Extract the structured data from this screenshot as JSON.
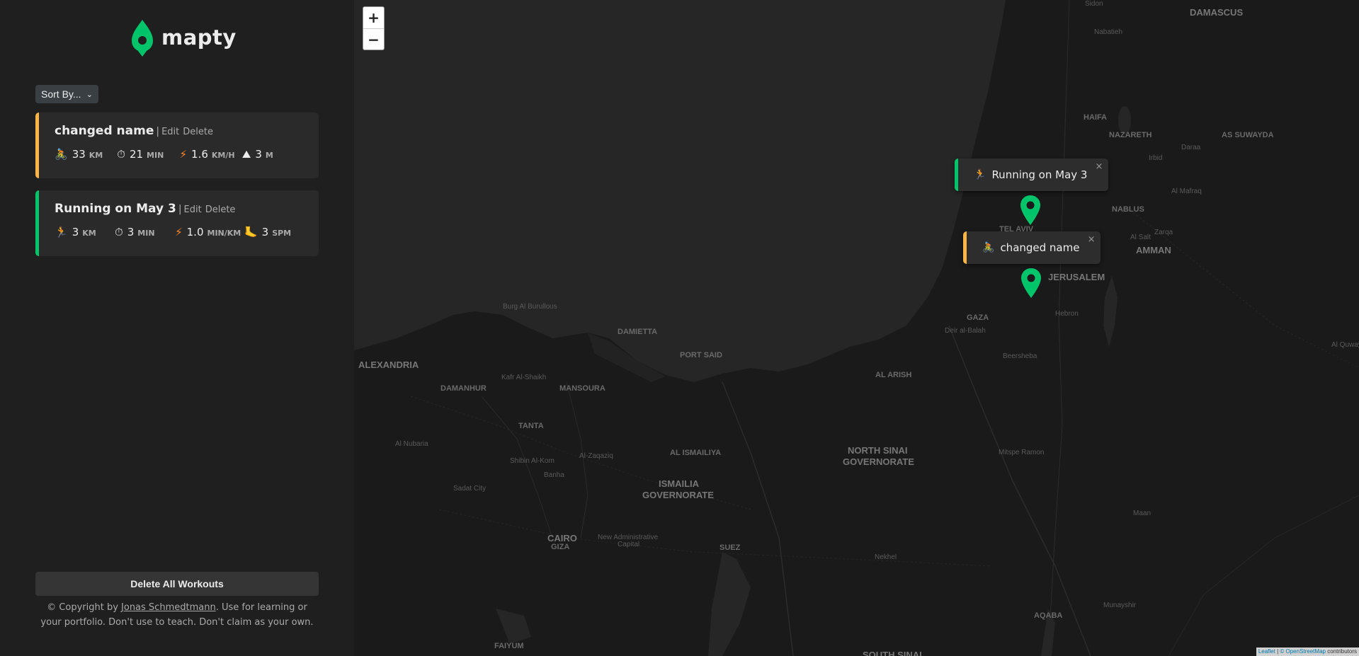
{
  "app": {
    "name": "mapty"
  },
  "sidebar": {
    "sort_label": "Sort By...",
    "workouts": [
      {
        "type": "cycling",
        "title": "changed name",
        "edit": "Edit",
        "delete": "Delete",
        "details": [
          {
            "icon": "🚴",
            "value": "33",
            "unit": "km"
          },
          {
            "icon": "⏱",
            "value": "21",
            "unit": "min"
          },
          {
            "icon": "⚡",
            "value": "1.6",
            "unit": "km/h"
          },
          {
            "icon": "⛰",
            "value": "3",
            "unit": "m"
          }
        ]
      },
      {
        "type": "running",
        "title": "Running on May 3",
        "edit": "Edit",
        "delete": "Delete",
        "details": [
          {
            "icon": "🏃",
            "value": "3",
            "unit": "km"
          },
          {
            "icon": "⏱",
            "value": "3",
            "unit": "min"
          },
          {
            "icon": "⚡",
            "value": "1.0",
            "unit": "min/km"
          },
          {
            "icon": "🦶",
            "value": "3",
            "unit": "spm"
          }
        ]
      }
    ],
    "delete_all_label": "Delete All Workouts",
    "copyright": {
      "prefix": "© Copyright by ",
      "author": "Jonas Schmedtmann",
      "suffix": ". Use for learning or your portfolio. Don't use to teach. Don't claim as your own."
    }
  },
  "map": {
    "zoom_in": "+",
    "zoom_out": "−",
    "popups": [
      {
        "type": "running",
        "icon": "🏃",
        "text": "Running on May 3",
        "close": "×"
      },
      {
        "type": "cycling",
        "icon": "🚴",
        "text": "changed name",
        "close": "×"
      }
    ],
    "places": {
      "damascus": "DAMASCUS",
      "sidon": "Sidon",
      "nabatieh": "Nabatieh",
      "haifa": "HAIFA",
      "nazareth": "NAZARETH",
      "as_suwayda": "AS SUWAYDA",
      "daraa": "Daraa",
      "irbid": "Irbid",
      "al_mafraq": "Al Mafraq",
      "nablus": "NABLUS",
      "tel_aviv": "TEL AVIV",
      "al_salt": "Al Salt",
      "zarqa": "Zarqa",
      "amman": "AMMAN",
      "jerusalem": "JERUSALEM",
      "gaza": "GAZA",
      "hebron": "Hebron",
      "deir_al_balah": "Deir al-Balah",
      "beersheba": "Beersheba",
      "burg_al_burullous": "Burg Al Burullous",
      "damietta": "DAMIETTA",
      "port_said": "PORT SAID",
      "alexandria": "ALEXANDRIA",
      "kafr_al_sheikh": "Kafr Al-Shaikh",
      "damanhur": "DAMANHUR",
      "mansoura": "MANSOURA",
      "al_arish": "AL ARISH",
      "tanta": "TANTA",
      "al_nubaria": "Al Nubaria",
      "north_sinai_1": "NORTH SINAI",
      "north_sinai_2": "GOVERNORATE",
      "al_ismailiya": "AL ISMAILIYA",
      "al_zaqaziq": "Al-Zaqaziq",
      "shibin": "Shibin Al-Kom",
      "banha": "Banha",
      "ismailia_1": "ISMAILIA",
      "ismailia_2": "GOVERNORATE",
      "mitspe_ramon": "Mitspe Ramon",
      "sadat_city": "Sadat City",
      "cairo_1": "CAIRO",
      "cairo_2": "GIZA",
      "new_admin_1": "New Administrative",
      "new_admin_2": "Capital",
      "suez": "SUEZ",
      "nekhel": "Nekhel",
      "maan": "Maan",
      "al_quwayra": "Al Quway",
      "munayshir": "Munayshir",
      "aqaba": "AQABA",
      "faiyum": "FAIYUM",
      "south_sinai": "SOUTH SINAI"
    },
    "attribution": {
      "leaflet": "Leaflet",
      "osm": "© OpenStreetMap",
      "suffix": " contributors"
    }
  }
}
